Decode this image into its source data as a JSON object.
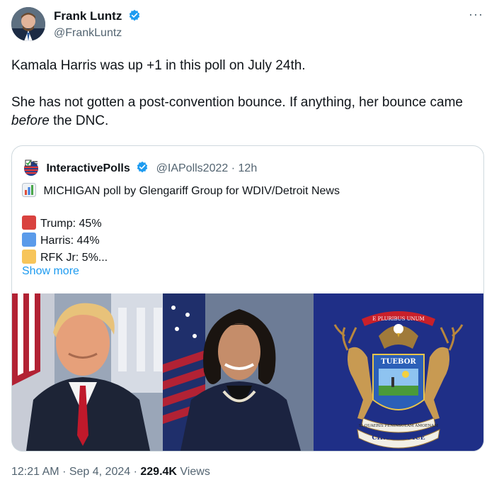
{
  "author": {
    "name": "Frank Luntz",
    "handle": "@FrankLuntz"
  },
  "tweet": {
    "line1": "Kamala Harris was up +1 in this poll on July 24th.",
    "line2_pre": "She has not gotten a post-convention bounce. If anything, her bounce came",
    "line2_em": "before",
    "line2_post": "the DNC."
  },
  "quoted": {
    "name": "InteractivePolls",
    "handle": "@IAPolls2022",
    "separator": "·",
    "time": "12h",
    "headline": "MICHIGAN poll by Glengariff Group for WDIV/Detroit News",
    "results": [
      {
        "label": "Trump: 45%",
        "color": "#d9423f"
      },
      {
        "label": "Harris: 44%",
        "color": "#5b9bea"
      },
      {
        "label": "RFK Jr: 5%...",
        "color": "#f7c55a"
      }
    ],
    "show_more": "Show more",
    "seal": {
      "banner_top": "E PLURIBUS UNUM",
      "shield_text": "TUEBOR",
      "ribbon": "SI QUAERIS PENINSULAM AMOENAM",
      "bottom": "CIRCUMSPICE"
    }
  },
  "meta": {
    "time": "12:21 AM",
    "dot1": "·",
    "date": "Sep 4, 2024",
    "dot2": "·",
    "views_count": "229.4K",
    "views_label": "Views"
  },
  "colors": {
    "accent": "#1d9bf0",
    "flag_blue": "#1f2f87"
  },
  "icons": [
    "verified-badge-icon",
    "more-options-icon",
    "checklist-flag-icon",
    "bar-chart-icon"
  ]
}
